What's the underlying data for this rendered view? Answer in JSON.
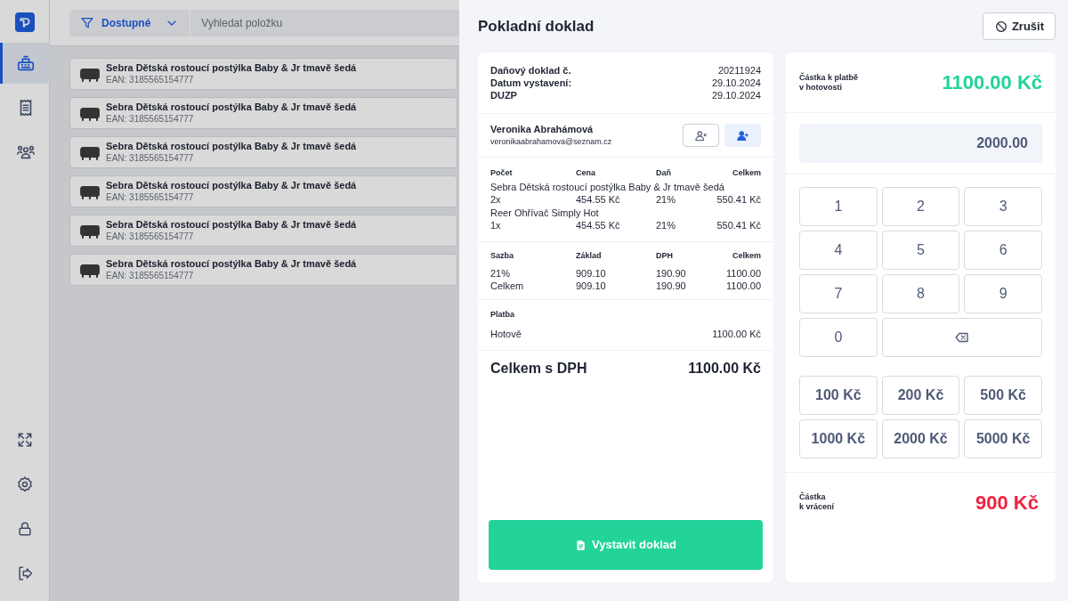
{
  "sidebar": {
    "nav_items": [
      {
        "selected": true
      },
      {
        "selected": false
      },
      {
        "selected": false
      }
    ]
  },
  "toolbar": {
    "filter": "Dostupné",
    "search": {
      "placeholder": "Vyhledat položku"
    }
  },
  "products": [
    {
      "name": "Sebra Dětská rostoucí postýlka Baby & Jr tmavě šedá",
      "ean": "EAN: 3185565154777"
    },
    {
      "name": "Sebra Dětská rostoucí postýlka Baby & Jr tmavě šedá",
      "ean": "EAN: 3185565154777"
    },
    {
      "name": "Sebra Dětská rostoucí postýlka Baby & Jr tmavě šedá",
      "ean": "EAN: 3185565154777"
    },
    {
      "name": "Sebra Dětská rostoucí postýlka Baby & Jr tmavě šedá",
      "ean": "EAN: 3185565154777"
    },
    {
      "name": "Sebra Dětská rostoucí postýlka Baby & Jr tmavě šedá",
      "ean": "EAN: 3185565154777"
    },
    {
      "name": "Sebra Dětská rostoucí postýlka Baby & Jr tmavě šedá",
      "ean": "EAN: 3185565154777"
    }
  ],
  "dialog": {
    "title": "Pokladní doklad",
    "cancel": "Zrušit",
    "receipt": {
      "header": [
        {
          "label": "Daňový doklad č.",
          "value": "20211924"
        },
        {
          "label": "Datum vystavení:",
          "value": "29.10.2024"
        },
        {
          "label": "DUZP",
          "value": "29.10.2024"
        }
      ],
      "customer": {
        "name": "Veronika Abrahámová",
        "email": "veronikaabrahamova@seznam.cz"
      },
      "items_columns": [
        "Počet",
        "Cena",
        "Daň",
        "Celkem"
      ],
      "items": [
        {
          "name": "Sebra Dětská rostoucí postýlka Baby & Jr tmavě šedá",
          "cells": [
            "2x",
            "454.55 Kč",
            "21%",
            "550.41 Kč"
          ]
        },
        {
          "name": "Reer Ohřívač Simply Hot",
          "cells": [
            "1x",
            "454.55 Kč",
            "21%",
            "550.41 Kč"
          ]
        }
      ],
      "tax_columns": [
        "Sazba",
        "Základ",
        "DPH",
        "Celkem"
      ],
      "tax_rows": [
        [
          "21%",
          "909.10",
          "190.90",
          "1100.00"
        ],
        [
          "Celkem",
          "909.10",
          "190.90",
          "1100.00"
        ]
      ],
      "payment": {
        "title": "Platba",
        "method": "Hotově",
        "amount": "1100.00 Kč"
      },
      "total": {
        "label": "Celkem s DPH",
        "value": "1100.00 Kč"
      },
      "issue_button": "Vystavit doklad"
    },
    "cash": {
      "due_label": "Částka k platbě\nv hotovosti",
      "due_value": "1100.00 Kč",
      "input": "2000.00",
      "keys": [
        {
          "kind": "digit",
          "label": "1"
        },
        {
          "kind": "digit",
          "label": "2"
        },
        {
          "kind": "digit",
          "label": "3"
        },
        {
          "kind": "digit",
          "label": "4"
        },
        {
          "kind": "digit",
          "label": "5"
        },
        {
          "kind": "digit",
          "label": "6"
        },
        {
          "kind": "digit",
          "label": "7"
        },
        {
          "kind": "digit",
          "label": "8"
        },
        {
          "kind": "digit",
          "label": "9"
        },
        {
          "kind": "digit",
          "label": "0"
        },
        {
          "kind": "backspace"
        }
      ],
      "quick_amounts": [
        "100 Kč",
        "200 Kč",
        "500 Kč",
        "1000 Kč",
        "2000 Kč",
        "5000 Kč"
      ],
      "change_label": "Částka\nk vrácení",
      "change_value": "900 Kč"
    }
  }
}
